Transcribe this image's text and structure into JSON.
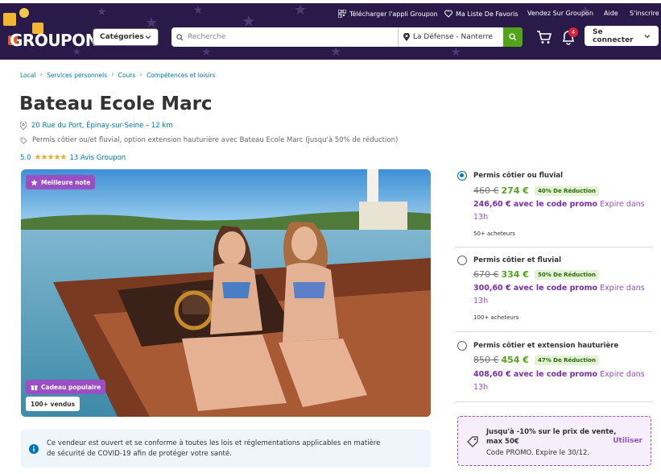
{
  "header": {
    "logo": "GROUPON",
    "utility": {
      "app": "Télécharger l'appli Groupon",
      "wishlist": "Ma Liste De Favoris",
      "sell": "Vendez Sur Groupon",
      "help": "Aide",
      "signup": "S'inscrire"
    },
    "categories_label": "Catégories",
    "search_placeholder": "Recherche",
    "location_value": "La Défense - Nanterre",
    "notifications_count": "4",
    "login_label": "Se connecter"
  },
  "breadcrumb": [
    "Local",
    "Services personnels",
    "Cours",
    "Compétences et loisirs"
  ],
  "deal": {
    "title": "Bateau Ecole Marc",
    "address": "20 Rue du Port, Épinay-sur-Seine",
    "distance_sep": "–",
    "distance": "12 km",
    "description": "Permis côtier ou/et fluvial, option extension hauturière avec Bateau Ecole Marc (jusqu'à 50% de réduction)",
    "rating_value": "5.0",
    "rating_stars": 5,
    "reviews": "13 Avis Groupon",
    "badge_top": "Meilleure note",
    "badge_gift": "Cadeau populaire",
    "sold": "100+ vendus"
  },
  "covid_notice": {
    "line1": "Ce vendeur est ouvert et se conforme à toutes les lois et réglementations applicables en matière",
    "line2": "de sécurité de COVID-19 afin de protéger votre santé."
  },
  "options": [
    {
      "name": "Permis côtier ou fluvial",
      "old_price": "460 €",
      "new_price": "274 €",
      "discount": "40% De Réduction",
      "promo_price": "246,60 € avec le code promo",
      "promo_expire_1": "Expire dans",
      "promo_expire_2": "13h",
      "buyers": "50+ acheteurs",
      "selected": true
    },
    {
      "name": "Permis côtier et fluvial",
      "old_price": "670 €",
      "new_price": "334 €",
      "discount": "50% De Réduction",
      "promo_price": "300,60 € avec le code promo",
      "promo_expire_1": "Expire dans",
      "promo_expire_2": "13h",
      "buyers": "100+ acheteurs",
      "selected": false
    },
    {
      "name": "Permis côtier et extension hauturière",
      "old_price": "850 €",
      "new_price": "454 €",
      "discount": "47% De Réduction",
      "promo_price": "408,60 € avec le code promo",
      "promo_expire_1": "Expire dans",
      "promo_expire_2": "13h",
      "buyers": "",
      "selected": false
    }
  ],
  "coupon": {
    "line1": "Jusqu'à -10% sur le prix de vente, max 50€",
    "line2": "Code PROMO. Expire le 30/12.",
    "action": "Utiliser"
  }
}
